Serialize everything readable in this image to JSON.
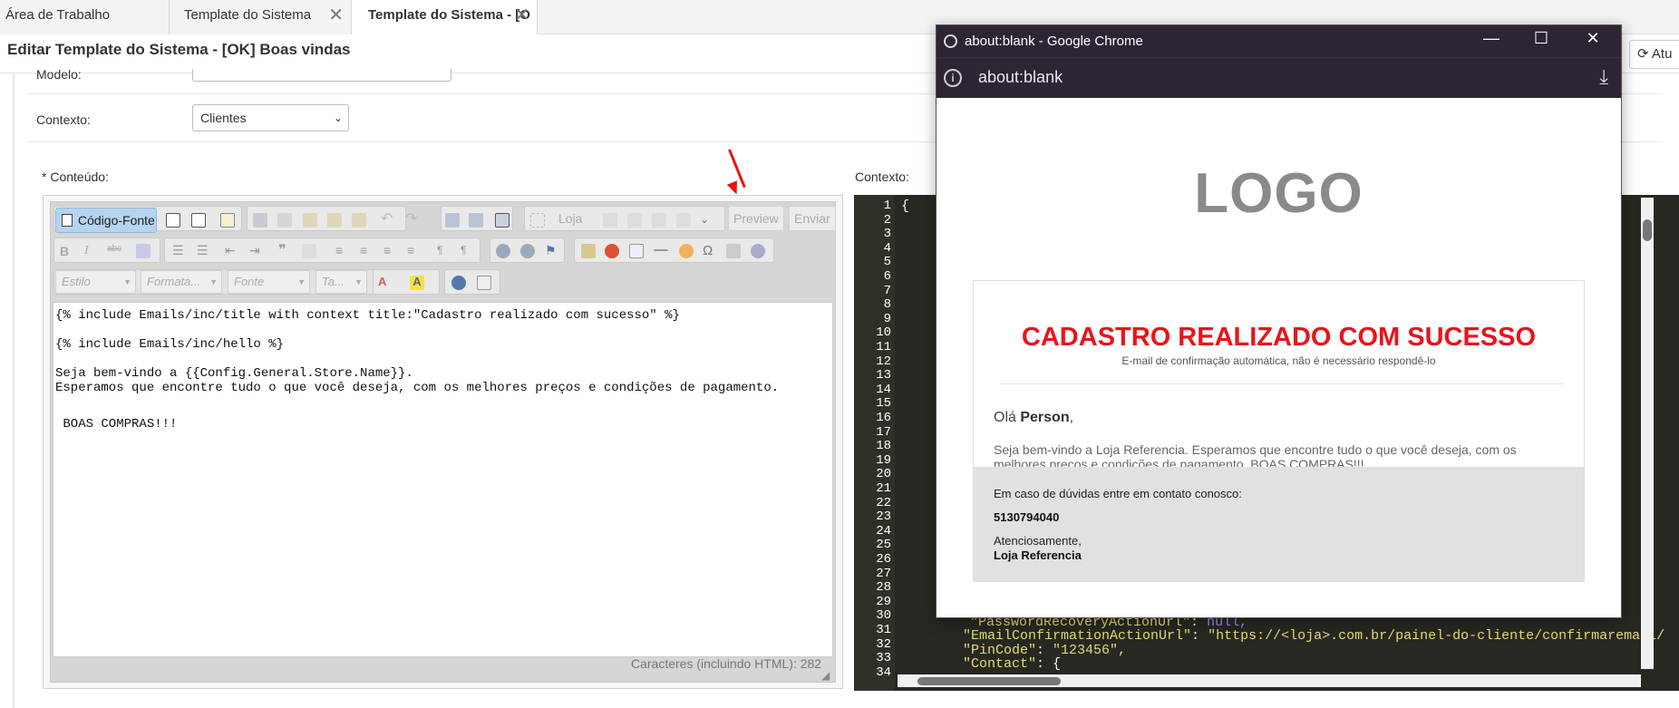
{
  "tabs": [
    {
      "label": "Área de Trabalho"
    },
    {
      "label": "Template do Sistema"
    },
    {
      "label": "Template do Sistema - [O"
    }
  ],
  "page": {
    "title": "Editar Template do Sistema - [OK] Boas vindas",
    "refresh_label": "Atu"
  },
  "form": {
    "modelo_label": "Modelo:",
    "contexto_label": "Contexto:",
    "contexto_value": "Clientes",
    "conteudo_label": "* Conteúdo:",
    "contexto_panel_label": "Contexto:"
  },
  "editor": {
    "source_button": "Código-Fonte",
    "loja_button": "Loja",
    "preview_button": "Preview",
    "enviar_button": "Enviar",
    "combo_estilo": "Estilo",
    "combo_formata": "Formata...",
    "combo_fonte": "Fonte",
    "combo_tamanho": "Ta...",
    "lines": [
      "{% include Emails/inc/title with context title:\"Cadastro realizado com sucesso\" %}",
      "{% include Emails/inc/hello %}",
      "Seja bem-vindo a {{Config.General.Store.Name}}.",
      "Esperamos que encontre tudo o que você deseja, com os melhores preços e condições de pagamento.",
      " BOAS COMPRAS!!!"
    ],
    "char_count": "Caracteres (incluindo HTML): 282"
  },
  "code": {
    "line_numbers": [
      "1",
      "2",
      "3",
      "4",
      "5",
      "6",
      "7",
      "8",
      "9",
      "10",
      "11",
      "12",
      "13",
      "14",
      "15",
      "16",
      "17",
      "18",
      "19",
      "20",
      "21",
      "22",
      "23",
      "24",
      "25",
      "26",
      "27",
      "28",
      "29",
      "30",
      "31",
      "32",
      "33",
      "34"
    ],
    "line1": "{",
    "line30_key": "\"PasswordRecoveryActionUrl\"",
    "line30_val": "null,",
    "line31_key": "\"EmailConfirmationActionUrl\"",
    "line31_val": "\"https://<loja>.com.br/painel-do-cliente/confirmaremail/",
    "line32_key": "\"PinCode\"",
    "line32_val": "\"123456\",",
    "line33_key": "\"Contact\"",
    "line33_val": "{"
  },
  "popup": {
    "window_title": "about:blank - Google Chrome",
    "url": "about:blank",
    "logo": "LOGO",
    "email_title": "CADASTRO REALIZADO COM SUCESSO",
    "email_subtitle": "E-mail de confirmação automática, não é necessário respondê-lo",
    "hello_prefix": "Olá ",
    "hello_name": "Person",
    "hello_suffix": ",",
    "body": "Seja bem-vindo a Loja Referencia. Esperamos que encontre tudo o que você deseja, com os melhores preços e condições de pagamento. BOAS COMPRAS!!!",
    "footer_line1": "Em caso de dúvidas entre em contato conosco:",
    "footer_phone": "5130794040",
    "footer_regards": "Atenciosamente,",
    "footer_store": "Loja Referencia"
  }
}
